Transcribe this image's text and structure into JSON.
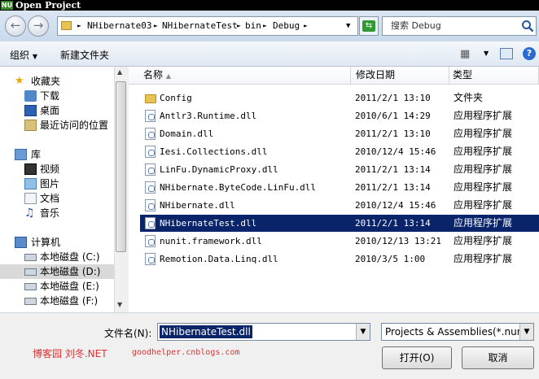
{
  "window": {
    "title": "Open Project",
    "app_icon": "NU"
  },
  "nav": {
    "back_icon": "back-arrow-icon",
    "forward_icon": "forward-arrow-icon",
    "breadcrumb": [
      "NHibernate03",
      "NHibernateTest",
      "bin",
      "Debug"
    ],
    "search_placeholder": "搜索 Debug"
  },
  "toolbar": {
    "organize": "组织",
    "new_folder": "新建文件夹"
  },
  "sidebar": {
    "items": [
      {
        "label": "收藏夹",
        "icon": "star-icon",
        "level": 0
      },
      {
        "label": "下载",
        "icon": "download-folder-icon",
        "level": 1
      },
      {
        "label": "桌面",
        "icon": "desktop-icon",
        "level": 1
      },
      {
        "label": "最近访问的位置",
        "icon": "recent-places-icon",
        "level": 1
      },
      {
        "label": "库",
        "icon": "library-icon",
        "level": 0
      },
      {
        "label": "视频",
        "icon": "video-icon",
        "level": 1
      },
      {
        "label": "图片",
        "icon": "pictures-icon",
        "level": 1
      },
      {
        "label": "文档",
        "icon": "documents-icon",
        "level": 1
      },
      {
        "label": "音乐",
        "icon": "music-icon",
        "level": 1
      },
      {
        "label": "计算机",
        "icon": "computer-icon",
        "level": 0
      },
      {
        "label": "本地磁盘 (C:)",
        "icon": "drive-icon",
        "level": 1
      },
      {
        "label": "本地磁盘 (D:)",
        "icon": "drive-icon",
        "level": 1,
        "selected": true
      },
      {
        "label": "本地磁盘 (E:)",
        "icon": "drive-icon",
        "level": 1
      },
      {
        "label": "本地磁盘 (F:)",
        "icon": "drive-icon",
        "level": 1
      }
    ]
  },
  "list": {
    "headers": {
      "name": "名称",
      "modified": "修改日期",
      "type": "类型"
    },
    "rows": [
      {
        "name": "Config",
        "date": "2011/2/1 13:10",
        "type": "文件夹",
        "kind": "folder"
      },
      {
        "name": "Antlr3.Runtime.dll",
        "date": "2010/6/1 14:29",
        "type": "应用程序扩展",
        "kind": "dll"
      },
      {
        "name": "Domain.dll",
        "date": "2011/2/1 13:10",
        "type": "应用程序扩展",
        "kind": "dll"
      },
      {
        "name": "Iesi.Collections.dll",
        "date": "2010/12/4 15:46",
        "type": "应用程序扩展",
        "kind": "dll"
      },
      {
        "name": "LinFu.DynamicProxy.dll",
        "date": "2011/2/1 13:14",
        "type": "应用程序扩展",
        "kind": "dll"
      },
      {
        "name": "NHibernate.ByteCode.LinFu.dll",
        "date": "2011/2/1 13:14",
        "type": "应用程序扩展",
        "kind": "dll"
      },
      {
        "name": "NHibernate.dll",
        "date": "2010/12/4 15:46",
        "type": "应用程序扩展",
        "kind": "dll"
      },
      {
        "name": "NHibernateTest.dll",
        "date": "2011/2/1 13:14",
        "type": "应用程序扩展",
        "kind": "dll",
        "selected": true
      },
      {
        "name": "nunit.framework.dll",
        "date": "2010/12/13 13:21",
        "type": "应用程序扩展",
        "kind": "dll"
      },
      {
        "name": "Remotion.Data.Linq.dll",
        "date": "2010/3/5 1:00",
        "type": "应用程序扩展",
        "kind": "dll"
      }
    ]
  },
  "footer": {
    "filename_label": "文件名(N):",
    "filename_value": "NHibernateTest.dll",
    "filter_value": "Projects & Assemblies(*.nuni",
    "open": "打开(O)",
    "cancel": "取消"
  },
  "watermark": {
    "left": "博客园  刘冬.NET",
    "right": "goodhelper.cnblogs.com"
  },
  "colors": {
    "selection": "#0a246a",
    "accent": "#2f9a2f"
  }
}
